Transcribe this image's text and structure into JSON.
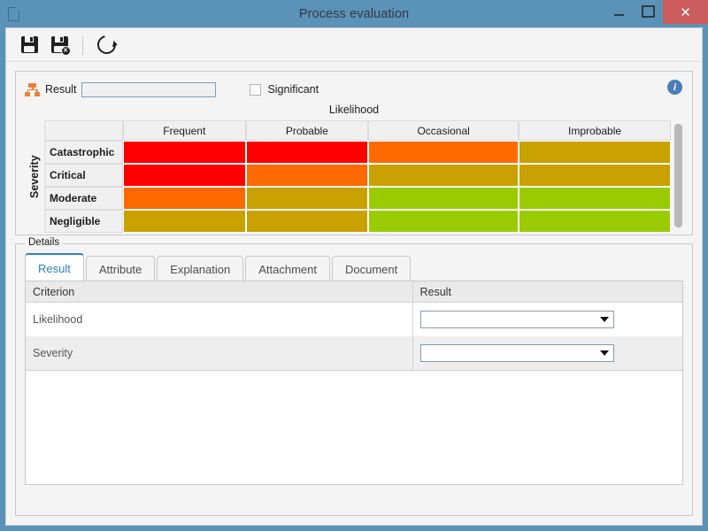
{
  "window": {
    "title": "Process evaluation",
    "app_icon": "document-icon",
    "minimize_label": "",
    "maximize_label": "",
    "close_label": "✕",
    "title_bar_color": "#5b92b8",
    "close_button_color": "#cd5c5c"
  },
  "toolbar": {
    "buttons": [
      {
        "name": "save-button",
        "icon": "floppy-disk-icon",
        "tooltip": "Save"
      },
      {
        "name": "save-and-close-button",
        "icon": "floppy-disk-x-icon",
        "tooltip": "Save and close"
      },
      {
        "name": "refresh-button",
        "icon": "refresh-icon",
        "tooltip": "Refresh"
      }
    ]
  },
  "result_panel": {
    "result_label": "Result",
    "result_icon": "sitemap-icon",
    "result_value": "",
    "result_placeholder": "",
    "significant_label": "Significant",
    "significant_checked": false,
    "info_icon_label": "i"
  },
  "matrix": {
    "column_axis_title": "Likelihood",
    "row_axis_title": "Severity",
    "columns": [
      "Frequent",
      "Probable",
      "Occasional",
      "Improbable"
    ],
    "rows": [
      "Catastrophic",
      "Critical",
      "Moderate",
      "Negligible"
    ],
    "colors": {
      "red": "#ff0000",
      "orange": "#ff6a00",
      "yellow": "#c9a100",
      "green": "#99cc00"
    },
    "cells": [
      [
        "#ff0000",
        "#ff0000",
        "#ff6a00",
        "#c9a100"
      ],
      [
        "#ff0000",
        "#ff6a00",
        "#c9a100",
        "#c9a100"
      ],
      [
        "#ff6a00",
        "#c9a100",
        "#99cc00",
        "#99cc00"
      ],
      [
        "#c9a100",
        "#c9a100",
        "#99cc00",
        "#99cc00"
      ]
    ]
  },
  "details": {
    "legend": "Details",
    "tabs": [
      {
        "label": "Result",
        "active": true
      },
      {
        "label": "Attribute",
        "active": false
      },
      {
        "label": "Explanation",
        "active": false
      },
      {
        "label": "Attachment",
        "active": false
      },
      {
        "label": "Document",
        "active": false
      }
    ],
    "table": {
      "headers": [
        "Criterion",
        "Result"
      ],
      "rows": [
        {
          "criterion": "Likelihood",
          "result_value": ""
        },
        {
          "criterion": "Severity",
          "result_value": ""
        }
      ]
    }
  }
}
